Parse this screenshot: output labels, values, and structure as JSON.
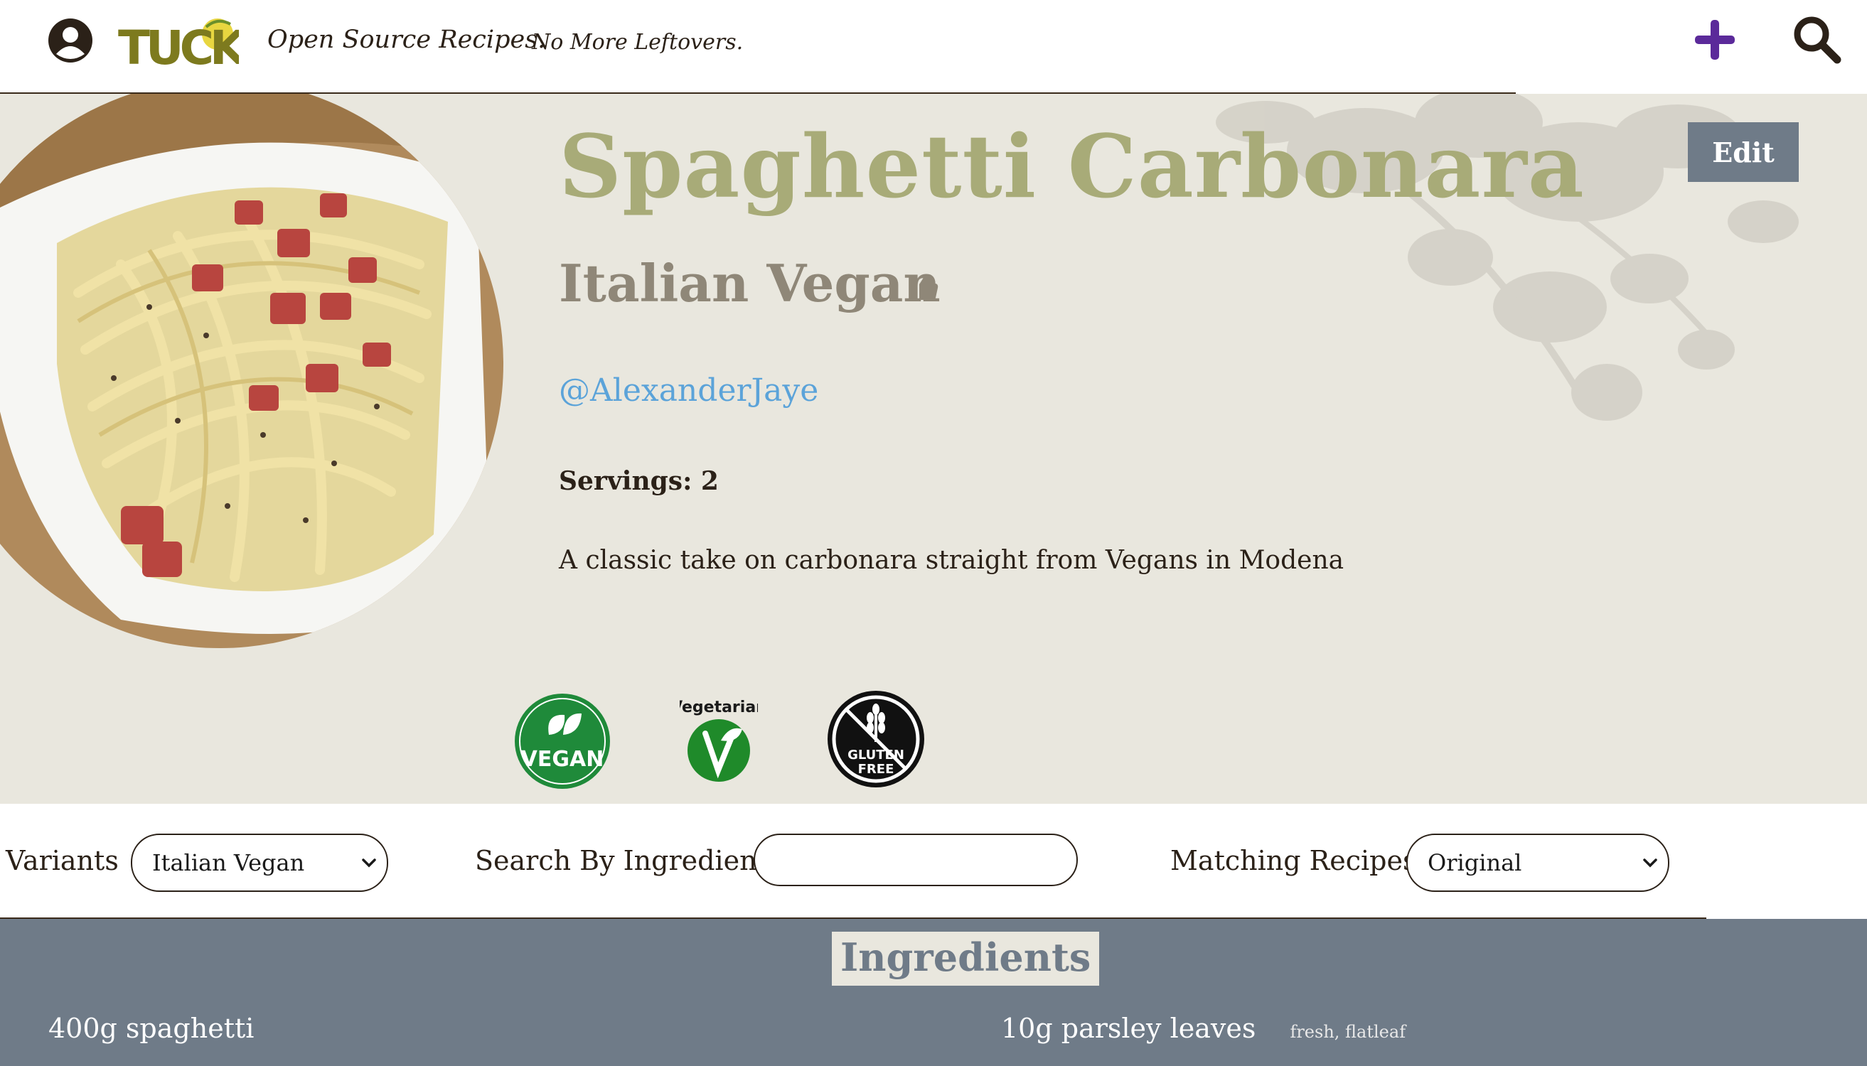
{
  "header": {
    "logo_text": "TUCK",
    "tagline_primary": "Open Source Recipes.",
    "tagline_secondary": "No More Leftovers."
  },
  "recipe": {
    "title": "Spaghetti Carbonara",
    "variant_name": "Italian Vegan",
    "author": "@AlexanderJaye",
    "servings_label": "Servings:",
    "servings_value": "2",
    "description": "A classic take on carbonara straight from Vegans in Modena",
    "edit_label": "Edit",
    "diet_badges": {
      "vegan": "VEGAN",
      "vegetarian": "Vegetarian",
      "gluten_free_line1": "GLUTEN",
      "gluten_free_line2": "FREE"
    }
  },
  "filters": {
    "variants_label": "Variants",
    "variants_selected": "Italian Vegan",
    "search_label": "Search By Ingredient",
    "search_value": "",
    "matching_label": "Matching Recipes",
    "matching_selected": "Original"
  },
  "ingredients": {
    "title": "Ingredients",
    "items": [
      {
        "text": "400g spaghetti",
        "note": ""
      },
      {
        "text": "10g parsley leaves",
        "note": "fresh, flatleaf"
      }
    ]
  },
  "colors": {
    "title": "#a8ab78",
    "hero_bg": "#e9e7de",
    "slate": "#6f7b88",
    "link": "#5ba3d9",
    "plus": "#5b2a9a"
  }
}
